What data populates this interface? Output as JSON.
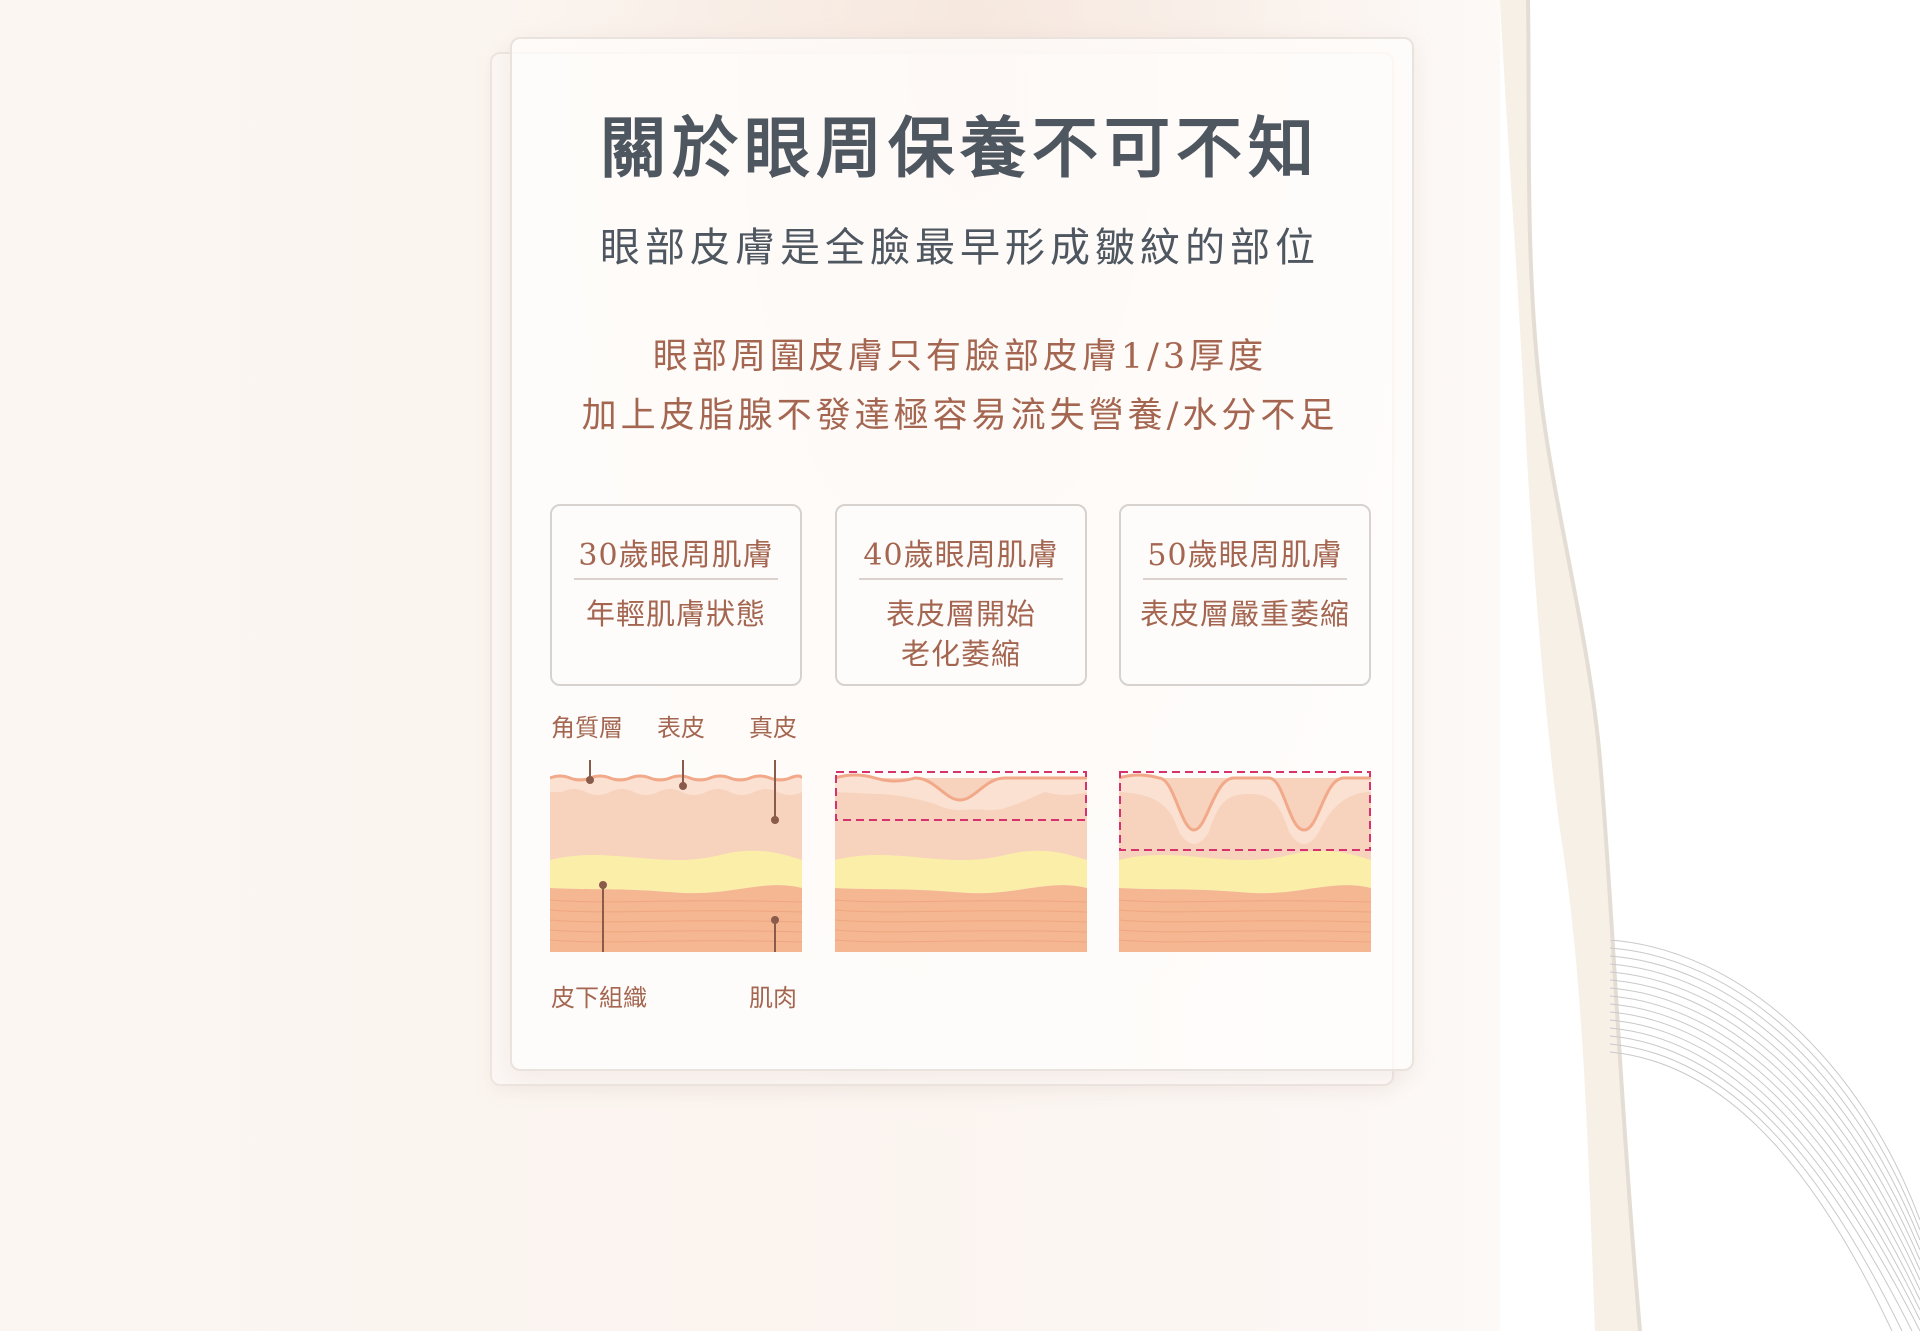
{
  "title": "關於眼周保養不可不知",
  "subtitle": "眼部皮膚是全臉最早形成皺紋的部位",
  "description": [
    "眼部周圍皮膚只有臉部皮膚1/3厚度",
    "加上皮脂腺不發達極容易流失營養/水分不足"
  ],
  "stages": [
    {
      "age": "30歲眼周肌膚",
      "desc": "年輕肌膚狀態"
    },
    {
      "age": "40歲眼周肌膚",
      "desc": "表皮層開始\n老化萎縮"
    },
    {
      "age": "50歲眼周肌膚",
      "desc": "表皮層嚴重萎縮"
    }
  ],
  "layer_labels": {
    "stratum_corneum": "角質層",
    "epidermis": "表皮",
    "dermis": "真皮",
    "subcutaneous": "皮下組織",
    "muscle": "肌肉"
  },
  "colors": {
    "title": "#4e5660",
    "accent": "#a46650",
    "highlight_box": "#d6336c",
    "dermis": "#f7d2bd",
    "fat": "#fbeea8",
    "muscle": "#f4b792"
  }
}
